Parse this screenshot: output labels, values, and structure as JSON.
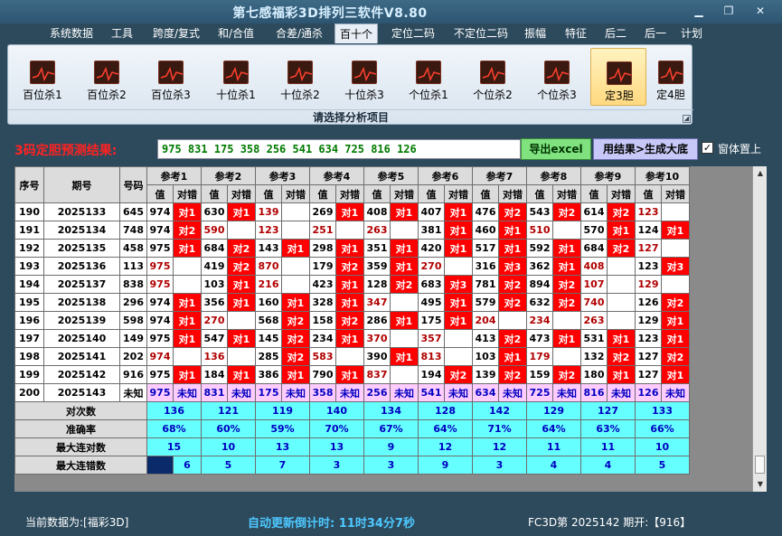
{
  "window": {
    "title": "第七感福彩3D排列三软件V8.80"
  },
  "menu": [
    {
      "label": "系统数据"
    },
    {
      "label": "工具"
    },
    {
      "label": "跨度/复式"
    },
    {
      "label": "和/合值"
    },
    {
      "label": "合差/通杀"
    },
    {
      "label": "百十个",
      "active": true
    },
    {
      "label": "定位二码"
    },
    {
      "label": "不定位二码"
    },
    {
      "label": "振幅"
    },
    {
      "label": "特征"
    },
    {
      "label": "后二"
    },
    {
      "label": "后一"
    },
    {
      "label": "计划"
    }
  ],
  "ribbon": {
    "buttons": [
      {
        "label": "百位杀1"
      },
      {
        "label": "百位杀2"
      },
      {
        "label": "百位杀3"
      },
      {
        "label": "十位杀1"
      },
      {
        "label": "十位杀2"
      },
      {
        "label": "十位杀3"
      },
      {
        "label": "个位杀1"
      },
      {
        "label": "个位杀2"
      },
      {
        "label": "个位杀3"
      },
      {
        "label": "定3胆",
        "selected": true
      },
      {
        "label": "定4胆"
      }
    ],
    "caption": "请选择分析项目"
  },
  "prediction": {
    "label": "3码定胆预测结果:",
    "value": "975 831 175 358 256 541 634 725 816 126",
    "export_label": "导出excel",
    "generate_label": "用结果>生成大底",
    "topmost_label": "窗体置上",
    "topmost_checked": "✓"
  },
  "grid": {
    "headers": {
      "seq": "序号",
      "period": "期号",
      "number": "号码",
      "value": "值",
      "result": "对错"
    },
    "refs": [
      "参考1",
      "参考2",
      "参考3",
      "参考4",
      "参考5",
      "参考6",
      "参考7",
      "参考8",
      "参考9",
      "参考10"
    ],
    "rows": [
      {
        "seq": "190",
        "period": "2025133",
        "number": "645",
        "cells": [
          [
            "974",
            "对1"
          ],
          [
            "630",
            "对1"
          ],
          [
            "139",
            ""
          ],
          [
            "269",
            "对1"
          ],
          [
            "408",
            "对1"
          ],
          [
            "407",
            "对1"
          ],
          [
            "476",
            "对2"
          ],
          [
            "543",
            "对2"
          ],
          [
            "614",
            "对2"
          ],
          [
            "123",
            ""
          ]
        ]
      },
      {
        "seq": "191",
        "period": "2025134",
        "number": "748",
        "cells": [
          [
            "974",
            "对2"
          ],
          [
            "590",
            ""
          ],
          [
            "123",
            ""
          ],
          [
            "251",
            ""
          ],
          [
            "263",
            ""
          ],
          [
            "381",
            "对1"
          ],
          [
            "460",
            "对1"
          ],
          [
            "510",
            ""
          ],
          [
            "570",
            "对1"
          ],
          [
            "124",
            "对1"
          ]
        ]
      },
      {
        "seq": "192",
        "period": "2025135",
        "number": "458",
        "cells": [
          [
            "975",
            "对1"
          ],
          [
            "684",
            "对2"
          ],
          [
            "143",
            "对1"
          ],
          [
            "298",
            "对1"
          ],
          [
            "351",
            "对1"
          ],
          [
            "420",
            "对1"
          ],
          [
            "517",
            "对1"
          ],
          [
            "592",
            "对1"
          ],
          [
            "684",
            "对2"
          ],
          [
            "127",
            ""
          ]
        ]
      },
      {
        "seq": "193",
        "period": "2025136",
        "number": "113",
        "cells": [
          [
            "975",
            ""
          ],
          [
            "419",
            "对2"
          ],
          [
            "870",
            ""
          ],
          [
            "179",
            "对2"
          ],
          [
            "359",
            "对1"
          ],
          [
            "270",
            ""
          ],
          [
            "316",
            "对3"
          ],
          [
            "362",
            "对1"
          ],
          [
            "408",
            ""
          ],
          [
            "123",
            "对3"
          ]
        ]
      },
      {
        "seq": "194",
        "period": "2025137",
        "number": "838",
        "cells": [
          [
            "975",
            ""
          ],
          [
            "103",
            "对1"
          ],
          [
            "216",
            ""
          ],
          [
            "423",
            "对1"
          ],
          [
            "128",
            "对2"
          ],
          [
            "683",
            "对3"
          ],
          [
            "781",
            "对2"
          ],
          [
            "894",
            "对2"
          ],
          [
            "107",
            ""
          ],
          [
            "129",
            ""
          ]
        ]
      },
      {
        "seq": "195",
        "period": "2025138",
        "number": "296",
        "cells": [
          [
            "974",
            "对1"
          ],
          [
            "356",
            "对1"
          ],
          [
            "160",
            "对1"
          ],
          [
            "328",
            "对1"
          ],
          [
            "347",
            ""
          ],
          [
            "495",
            "对1"
          ],
          [
            "579",
            "对2"
          ],
          [
            "632",
            "对2"
          ],
          [
            "740",
            ""
          ],
          [
            "126",
            "对2"
          ]
        ]
      },
      {
        "seq": "196",
        "period": "2025139",
        "number": "598",
        "cells": [
          [
            "974",
            "对1"
          ],
          [
            "270",
            ""
          ],
          [
            "568",
            "对2"
          ],
          [
            "158",
            "对2"
          ],
          [
            "286",
            "对1"
          ],
          [
            "175",
            "对1"
          ],
          [
            "204",
            ""
          ],
          [
            "234",
            ""
          ],
          [
            "263",
            ""
          ],
          [
            "129",
            "对1"
          ]
        ]
      },
      {
        "seq": "197",
        "period": "2025140",
        "number": "149",
        "cells": [
          [
            "975",
            "对1"
          ],
          [
            "547",
            "对1"
          ],
          [
            "145",
            "对2"
          ],
          [
            "234",
            "对1"
          ],
          [
            "370",
            ""
          ],
          [
            "357",
            ""
          ],
          [
            "413",
            "对2"
          ],
          [
            "473",
            "对1"
          ],
          [
            "531",
            "对1"
          ],
          [
            "123",
            "对1"
          ]
        ]
      },
      {
        "seq": "198",
        "period": "2025141",
        "number": "202",
        "cells": [
          [
            "974",
            ""
          ],
          [
            "136",
            ""
          ],
          [
            "285",
            "对2"
          ],
          [
            "583",
            ""
          ],
          [
            "390",
            "对1"
          ],
          [
            "813",
            ""
          ],
          [
            "103",
            "对1"
          ],
          [
            "179",
            ""
          ],
          [
            "132",
            "对2"
          ],
          [
            "127",
            "对2"
          ]
        ]
      },
      {
        "seq": "199",
        "period": "2025142",
        "number": "916",
        "cells": [
          [
            "975",
            "对1"
          ],
          [
            "184",
            "对1"
          ],
          [
            "386",
            "对1"
          ],
          [
            "790",
            "对1"
          ],
          [
            "837",
            ""
          ],
          [
            "194",
            "对2"
          ],
          [
            "139",
            "对2"
          ],
          [
            "159",
            "对2"
          ],
          [
            "180",
            "对1"
          ],
          [
            "127",
            "对1"
          ]
        ]
      },
      {
        "seq": "200",
        "period": "2025143",
        "number": "未知",
        "unknown": true,
        "cells": [
          [
            "975",
            "未知"
          ],
          [
            "831",
            "未知"
          ],
          [
            "175",
            "未知"
          ],
          [
            "358",
            "未知"
          ],
          [
            "256",
            "未知"
          ],
          [
            "541",
            "未知"
          ],
          [
            "634",
            "未知"
          ],
          [
            "725",
            "未知"
          ],
          [
            "816",
            "未知"
          ],
          [
            "126",
            "未知"
          ]
        ]
      }
    ],
    "stats": [
      {
        "label": "对次数",
        "values": [
          "136",
          "121",
          "119",
          "140",
          "134",
          "128",
          "142",
          "129",
          "127",
          "133"
        ]
      },
      {
        "label": "准确率",
        "values": [
          "68%",
          "60%",
          "59%",
          "70%",
          "67%",
          "64%",
          "71%",
          "64%",
          "63%",
          "66%"
        ]
      },
      {
        "label": "最大连对数",
        "values": [
          "15",
          "10",
          "13",
          "13",
          "9",
          "12",
          "12",
          "11",
          "11",
          "10"
        ]
      },
      {
        "label": "最大连错数",
        "values": [
          "6",
          "5",
          "7",
          "3",
          "3",
          "9",
          "3",
          "4",
          "4",
          "5"
        ]
      }
    ]
  },
  "status": {
    "left": "当前数据为:[福彩3D]",
    "middle": "自动更新倒计时:   11时34分7秒",
    "right": "FC3D第 2025142 期开:【916】"
  },
  "colors": {
    "hit": "#ff0000",
    "miss_text": "#b00000",
    "stat_bg": "#66ffff",
    "unknown_bg": "#ffccff",
    "pred_text": "#007a00"
  }
}
